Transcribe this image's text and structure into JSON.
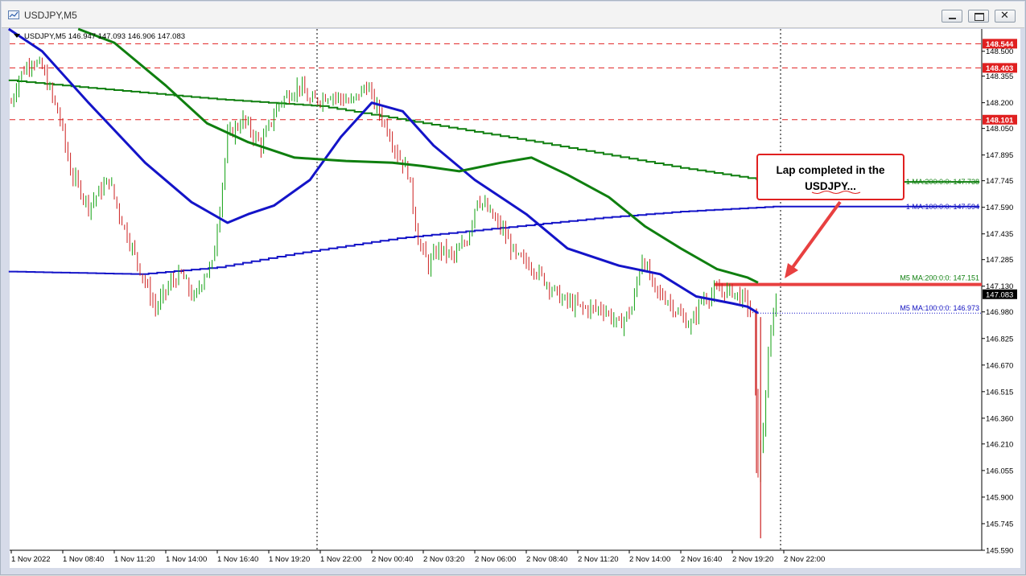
{
  "window": {
    "title": "USDJPY,M5",
    "controls": [
      "minimize",
      "restore",
      "close"
    ]
  },
  "chart_data": {
    "type": "candlestick",
    "symbol": "USDJPY",
    "timeframe": "M5",
    "ohlc_header": "USDJPY,M5  146.947 147.093 146.906 147.083",
    "grid": false,
    "ylim": [
      145.59,
      148.63
    ],
    "yticks": [
      148.5,
      148.355,
      148.2,
      148.05,
      147.895,
      147.745,
      147.59,
      147.435,
      147.285,
      147.13,
      146.98,
      146.825,
      146.67,
      146.515,
      146.36,
      146.21,
      146.055,
      145.9,
      145.745,
      145.59
    ],
    "ytick_labels": [
      "148.500",
      "148.355",
      "148.200",
      "148.050",
      "147.895",
      "147.745",
      "147.590",
      "147.435",
      "147.285",
      "147.130",
      "146.980",
      "146.825",
      "146.670",
      "146.515",
      "146.360",
      "146.210",
      "146.055",
      "145.900",
      "145.745",
      "145.590"
    ],
    "xtick_labels": [
      "1 Nov 2022",
      "1 Nov 08:40",
      "1 Nov 11:20",
      "1 Nov 14:00",
      "1 Nov 16:40",
      "1 Nov 19:20",
      "1 Nov 22:00",
      "2 Nov 00:40",
      "2 Nov 03:20",
      "2 Nov 06:00",
      "2 Nov 08:40",
      "2 Nov 11:20",
      "2 Nov 14:00",
      "2 Nov 16:40",
      "2 Nov 19:20",
      "2 Nov 22:00"
    ],
    "day_separators": [
      "1 Nov 22:00",
      "2 Nov 22:00"
    ],
    "price_path": {
      "x_labels_index": [
        0,
        0.15,
        0.4,
        0.6,
        0.95,
        1.15,
        1.5,
        1.9,
        2.1,
        2.6,
        2.8,
        3.1,
        3.3,
        3.55,
        3.75,
        3.9,
        4.05,
        4.2,
        4.5,
        4.85,
        5.2,
        5.6,
        5.8,
        6.2,
        6.6,
        6.9,
        7.05,
        7.3,
        7.5,
        7.7,
        7.9,
        8.1,
        8.3,
        8.6,
        8.85,
        9.05,
        9.3,
        9.55,
        9.8,
        10.1,
        10.4,
        10.7,
        11.1,
        11.5,
        11.8,
        12.05,
        12.25,
        12.5,
        12.75,
        13.0,
        13.2,
        13.4,
        13.7,
        14.0,
        14.25,
        14.4,
        14.5,
        14.6,
        14.7,
        14.8,
        14.9
      ],
      "close": [
        148.2,
        148.35,
        148.45,
        148.4,
        148.1,
        147.8,
        147.6,
        147.75,
        147.55,
        147.15,
        147.0,
        147.15,
        147.2,
        147.05,
        147.2,
        147.25,
        147.6,
        148.0,
        148.1,
        147.95,
        148.2,
        148.3,
        148.2,
        148.25,
        148.2,
        148.3,
        148.2,
        148.05,
        147.9,
        147.8,
        147.4,
        147.25,
        147.35,
        147.3,
        147.4,
        147.65,
        147.55,
        147.45,
        147.3,
        147.25,
        147.15,
        147.05,
        147.0,
        147.0,
        146.9,
        147.0,
        147.3,
        147.1,
        147.05,
        146.95,
        146.9,
        147.05,
        147.1,
        147.1,
        147.05,
        146.95,
        146.05,
        146.3,
        146.7,
        147.0,
        147.08
      ]
    },
    "series": [
      {
        "name": "M5 MA:100:0:0",
        "color": "#1010c0",
        "last": 146.973,
        "label": "M5 MA:100:0:0: 146.973"
      },
      {
        "name": "M5 MA:200:0:0",
        "color": "#108010",
        "last": 147.151,
        "label": "M5 MA:200:0:0: 147.151"
      },
      {
        "name": "H1 MA:100:0:0",
        "color": "#1010c0",
        "last": 147.594,
        "label": "1 MA:100:0:0: 147.594"
      },
      {
        "name": "H1 MA:200:0:0",
        "color": "#108010",
        "last": 147.738,
        "label": "1 MA:200:0:0: 147.738"
      }
    ],
    "horizontal_levels": [
      {
        "price": 148.544,
        "label": "148.544",
        "style": "dashed",
        "color": "#e02020"
      },
      {
        "price": 148.403,
        "label": "148.403",
        "style": "dashed",
        "color": "#e02020"
      },
      {
        "price": 148.101,
        "label": "148.101",
        "style": "dashed",
        "color": "#e02020"
      },
      {
        "price": 147.14,
        "label": "",
        "style": "solid-thick",
        "color": "#e84040"
      }
    ],
    "current_price": {
      "value": 147.083,
      "label": "147.083"
    },
    "annotations": [
      {
        "text_lines": [
          "Lap completed in the",
          "USDJPY..."
        ]
      }
    ]
  },
  "colors": {
    "bullish_candle": "#10a010",
    "bearish_candle": "#cc2020",
    "ma_blue": "#1414c8",
    "ma_green": "#0f7f0f",
    "level_red": "#e02020",
    "annotation_border": "#e02020"
  }
}
